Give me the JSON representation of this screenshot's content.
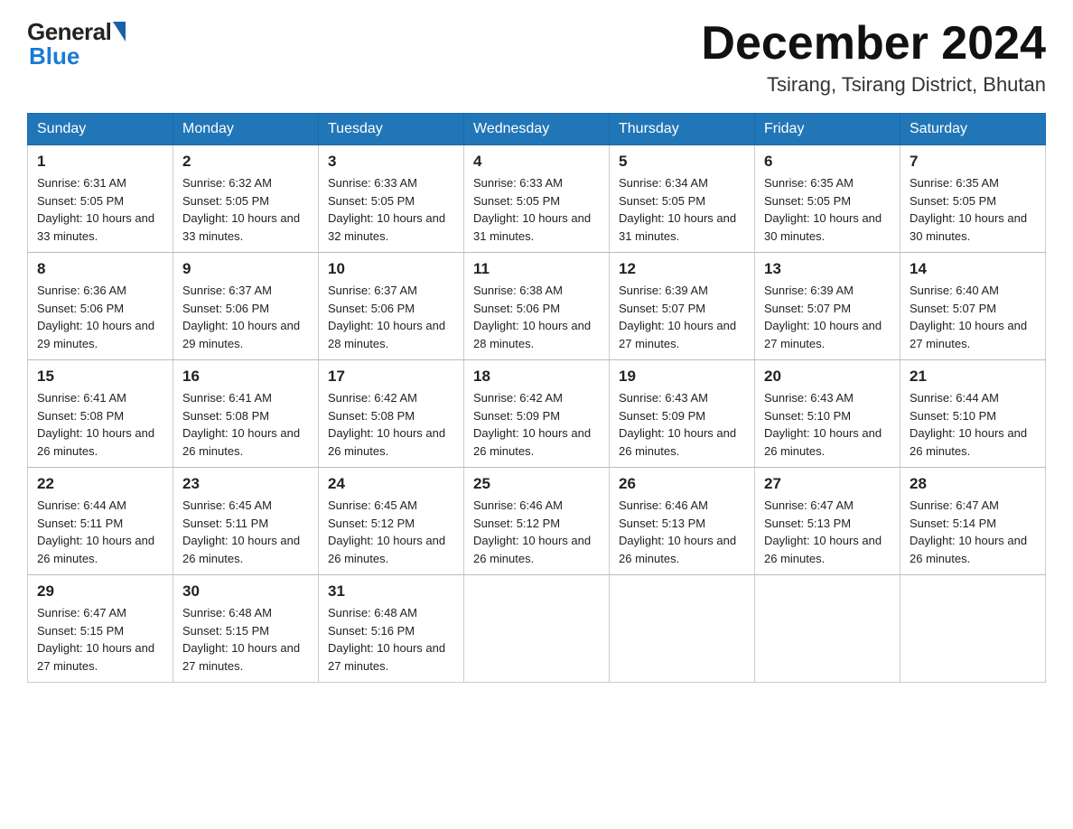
{
  "header": {
    "logo_text": "General",
    "logo_blue": "Blue",
    "month_title": "December 2024",
    "location": "Tsirang, Tsirang District, Bhutan"
  },
  "weekdays": [
    "Sunday",
    "Monday",
    "Tuesday",
    "Wednesday",
    "Thursday",
    "Friday",
    "Saturday"
  ],
  "weeks": [
    [
      {
        "day": "1",
        "sunrise": "6:31 AM",
        "sunset": "5:05 PM",
        "daylight": "10 hours and 33 minutes."
      },
      {
        "day": "2",
        "sunrise": "6:32 AM",
        "sunset": "5:05 PM",
        "daylight": "10 hours and 33 minutes."
      },
      {
        "day": "3",
        "sunrise": "6:33 AM",
        "sunset": "5:05 PM",
        "daylight": "10 hours and 32 minutes."
      },
      {
        "day": "4",
        "sunrise": "6:33 AM",
        "sunset": "5:05 PM",
        "daylight": "10 hours and 31 minutes."
      },
      {
        "day": "5",
        "sunrise": "6:34 AM",
        "sunset": "5:05 PM",
        "daylight": "10 hours and 31 minutes."
      },
      {
        "day": "6",
        "sunrise": "6:35 AM",
        "sunset": "5:05 PM",
        "daylight": "10 hours and 30 minutes."
      },
      {
        "day": "7",
        "sunrise": "6:35 AM",
        "sunset": "5:05 PM",
        "daylight": "10 hours and 30 minutes."
      }
    ],
    [
      {
        "day": "8",
        "sunrise": "6:36 AM",
        "sunset": "5:06 PM",
        "daylight": "10 hours and 29 minutes."
      },
      {
        "day": "9",
        "sunrise": "6:37 AM",
        "sunset": "5:06 PM",
        "daylight": "10 hours and 29 minutes."
      },
      {
        "day": "10",
        "sunrise": "6:37 AM",
        "sunset": "5:06 PM",
        "daylight": "10 hours and 28 minutes."
      },
      {
        "day": "11",
        "sunrise": "6:38 AM",
        "sunset": "5:06 PM",
        "daylight": "10 hours and 28 minutes."
      },
      {
        "day": "12",
        "sunrise": "6:39 AM",
        "sunset": "5:07 PM",
        "daylight": "10 hours and 27 minutes."
      },
      {
        "day": "13",
        "sunrise": "6:39 AM",
        "sunset": "5:07 PM",
        "daylight": "10 hours and 27 minutes."
      },
      {
        "day": "14",
        "sunrise": "6:40 AM",
        "sunset": "5:07 PM",
        "daylight": "10 hours and 27 minutes."
      }
    ],
    [
      {
        "day": "15",
        "sunrise": "6:41 AM",
        "sunset": "5:08 PM",
        "daylight": "10 hours and 26 minutes."
      },
      {
        "day": "16",
        "sunrise": "6:41 AM",
        "sunset": "5:08 PM",
        "daylight": "10 hours and 26 minutes."
      },
      {
        "day": "17",
        "sunrise": "6:42 AM",
        "sunset": "5:08 PM",
        "daylight": "10 hours and 26 minutes."
      },
      {
        "day": "18",
        "sunrise": "6:42 AM",
        "sunset": "5:09 PM",
        "daylight": "10 hours and 26 minutes."
      },
      {
        "day": "19",
        "sunrise": "6:43 AM",
        "sunset": "5:09 PM",
        "daylight": "10 hours and 26 minutes."
      },
      {
        "day": "20",
        "sunrise": "6:43 AM",
        "sunset": "5:10 PM",
        "daylight": "10 hours and 26 minutes."
      },
      {
        "day": "21",
        "sunrise": "6:44 AM",
        "sunset": "5:10 PM",
        "daylight": "10 hours and 26 minutes."
      }
    ],
    [
      {
        "day": "22",
        "sunrise": "6:44 AM",
        "sunset": "5:11 PM",
        "daylight": "10 hours and 26 minutes."
      },
      {
        "day": "23",
        "sunrise": "6:45 AM",
        "sunset": "5:11 PM",
        "daylight": "10 hours and 26 minutes."
      },
      {
        "day": "24",
        "sunrise": "6:45 AM",
        "sunset": "5:12 PM",
        "daylight": "10 hours and 26 minutes."
      },
      {
        "day": "25",
        "sunrise": "6:46 AM",
        "sunset": "5:12 PM",
        "daylight": "10 hours and 26 minutes."
      },
      {
        "day": "26",
        "sunrise": "6:46 AM",
        "sunset": "5:13 PM",
        "daylight": "10 hours and 26 minutes."
      },
      {
        "day": "27",
        "sunrise": "6:47 AM",
        "sunset": "5:13 PM",
        "daylight": "10 hours and 26 minutes."
      },
      {
        "day": "28",
        "sunrise": "6:47 AM",
        "sunset": "5:14 PM",
        "daylight": "10 hours and 26 minutes."
      }
    ],
    [
      {
        "day": "29",
        "sunrise": "6:47 AM",
        "sunset": "5:15 PM",
        "daylight": "10 hours and 27 minutes."
      },
      {
        "day": "30",
        "sunrise": "6:48 AM",
        "sunset": "5:15 PM",
        "daylight": "10 hours and 27 minutes."
      },
      {
        "day": "31",
        "sunrise": "6:48 AM",
        "sunset": "5:16 PM",
        "daylight": "10 hours and 27 minutes."
      },
      null,
      null,
      null,
      null
    ]
  ]
}
